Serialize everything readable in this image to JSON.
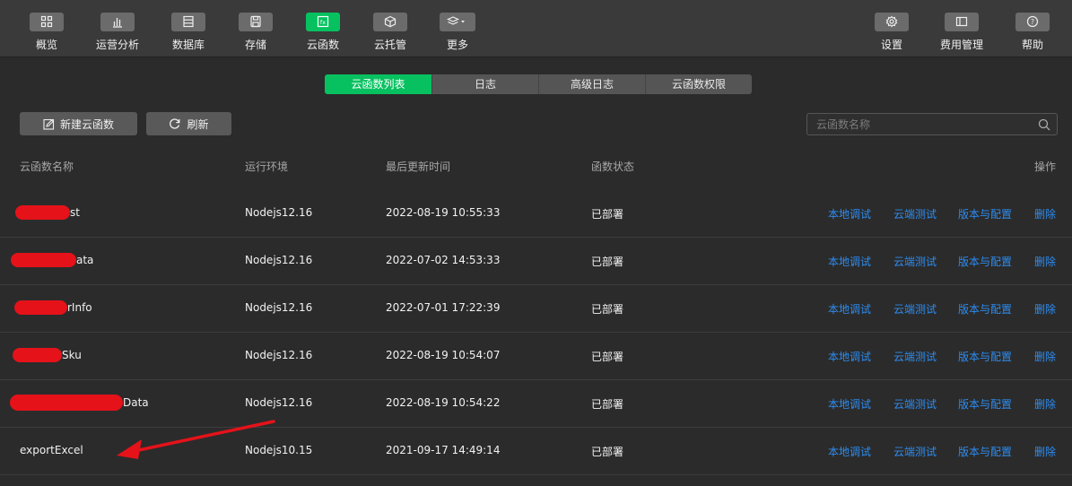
{
  "toolbar": {
    "left": [
      {
        "label": "概览",
        "icon": "grid-icon"
      },
      {
        "label": "运营分析",
        "icon": "bar-chart-icon"
      },
      {
        "label": "数据库",
        "icon": "database-icon"
      },
      {
        "label": "存储",
        "icon": "storage-icon"
      },
      {
        "label": "云函数",
        "icon": "function-icon"
      },
      {
        "label": "云托管",
        "icon": "cube-icon"
      },
      {
        "label": "更多",
        "icon": "layers-icon"
      }
    ],
    "right": [
      {
        "label": "设置",
        "icon": "gear-icon"
      },
      {
        "label": "费用管理",
        "icon": "billing-icon"
      },
      {
        "label": "帮助",
        "icon": "help-icon"
      }
    ],
    "active": "云函数"
  },
  "tabs": [
    "云函数列表",
    "日志",
    "高级日志",
    "云函数权限"
  ],
  "actions": {
    "new_label": "新建云函数",
    "refresh_label": "刷新"
  },
  "search": {
    "placeholder": "云函数名称"
  },
  "table": {
    "headers": {
      "name": "云函数名称",
      "runtime": "运行环境",
      "updated": "最后更新时间",
      "status": "函数状态",
      "ops": "操作"
    },
    "rows": [
      {
        "name": "st",
        "runtime": "Nodejs12.16",
        "updated": "2022-08-19 10:55:33",
        "status": "已部署"
      },
      {
        "name": "ata",
        "runtime": "Nodejs12.16",
        "updated": "2022-07-02 14:53:33",
        "status": "已部署"
      },
      {
        "name": "rInfo",
        "runtime": "Nodejs12.16",
        "updated": "2022-07-01 17:22:39",
        "status": "已部署"
      },
      {
        "name": "Sku",
        "runtime": "Nodejs12.16",
        "updated": "2022-08-19 10:54:07",
        "status": "已部署"
      },
      {
        "name": "Data",
        "runtime": "Nodejs12.16",
        "updated": "2022-08-19 10:54:22",
        "status": "已部署"
      },
      {
        "name": "exportExcel",
        "runtime": "Nodejs10.15",
        "updated": "2021-09-17 14:49:14",
        "status": "已部署"
      }
    ],
    "row_actions": [
      "本地调试",
      "云端测试",
      "版本与配置",
      "删除"
    ]
  },
  "colors": {
    "accent": "#07c160",
    "link": "#2d8cf0",
    "annotation": "#e5121a"
  }
}
